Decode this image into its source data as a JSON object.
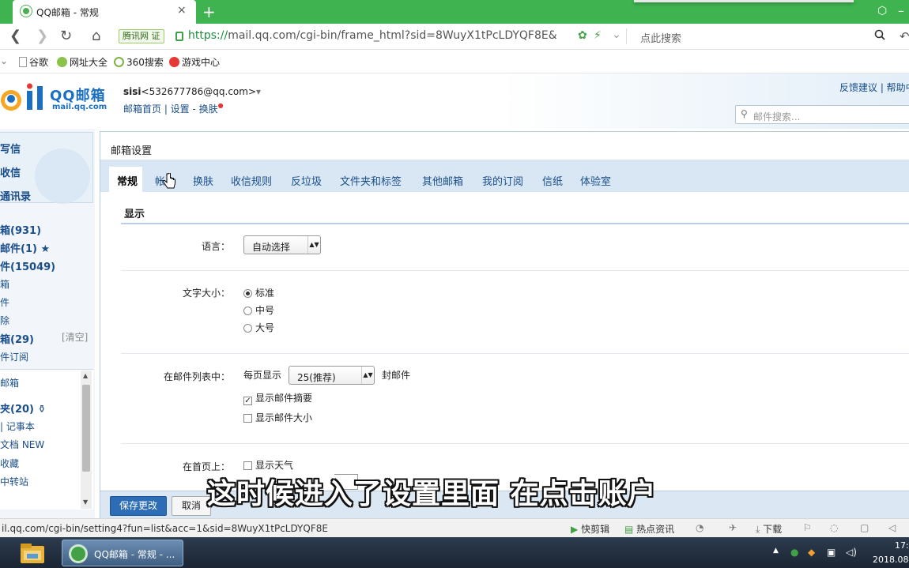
{
  "browser": {
    "tab_title": "QQ邮箱 - 常规",
    "tab_close": "×",
    "new_tab": "+",
    "tencent_badge": "腾讯网 证",
    "url_scheme": "https://",
    "url_rest": "mail.qq.com/cgi-bin/frame_html?sid=8WuyX1tPcLDYQF8E&",
    "search_placeholder": "点此搜索",
    "bookmarks": [
      "谷歌",
      "网址大全",
      "360搜索",
      "游戏中心"
    ]
  },
  "mail_header": {
    "logo_text": "QQ邮箱",
    "logo_sub": "mail.qq.com",
    "user_nick": "sisi",
    "user_email": "<532677786@qq.com>",
    "user_links": "邮箱首页 | 设置 - 换肤",
    "head_links": "反馈建议 | 帮助中",
    "search_placeholder": "邮件搜索..."
  },
  "sidebar": {
    "write": "写信",
    "receive": "收信",
    "contacts": "通讯录",
    "folders": [
      {
        "label": "箱(931)",
        "bold": true
      },
      {
        "label": "邮件(1) ★",
        "bold": true
      },
      {
        "label": "件(15049)",
        "bold": true
      },
      {
        "label": "箱",
        "bold": false
      },
      {
        "label": "件",
        "bold": false
      },
      {
        "label": "除",
        "bold": false
      },
      {
        "label": "箱(29)",
        "bold": true
      },
      {
        "label": "件订阅",
        "bold": false
      }
    ],
    "clear": "[清空]",
    "lower": [
      {
        "label": "邮箱",
        "bold": false
      },
      {
        "label": "夹(20) ⚱",
        "bold": true
      },
      {
        "label": "| 记事本",
        "bold": false
      },
      {
        "label": "文档 NEW",
        "bold": false
      },
      {
        "label": "收藏",
        "bold": false
      },
      {
        "label": "中转站",
        "bold": false
      }
    ]
  },
  "settings": {
    "title": "邮箱设置",
    "tabs": [
      "常规",
      "帐户",
      "换肤",
      "收信规则",
      "反垃圾",
      "文件夹和标签",
      "其他邮箱",
      "我的订阅",
      "信纸",
      "体验室"
    ],
    "section": "显示",
    "language_label": "语言：",
    "language_value": "自动选择",
    "font_label": "文字大小：",
    "font_options": [
      "标准",
      "中号",
      "大号"
    ],
    "list_label": "在邮件列表中：",
    "per_page_prefix": "每页显示",
    "per_page_value": "25(推荐)",
    "per_page_suffix": "封邮件",
    "show_summary": "显示邮件摘要",
    "show_size": "显示邮件大小",
    "home_label": "在首页上：",
    "show_weather": "显示天气",
    "save": "保存更改",
    "cancel": "取消"
  },
  "subtitle": "这时候进入了设置里面 在点击账户",
  "statusbar": {
    "url": "il.qq.com/cgi-bin/setting4?fun=list&acc=1&sid=8WuyX1tPcLDYQF8E",
    "items": [
      "快剪辑",
      "热点资讯",
      "下载"
    ]
  },
  "taskbar": {
    "window_label": "QQ邮箱 - 常规 - ...",
    "time": "17:",
    "date": "2018.08"
  },
  "colors": {
    "browser_green": "#3fb34f",
    "qq_blue": "#1a6fc2",
    "tab_bar": "#d9e7f4",
    "save_button": "#2d6db5"
  }
}
